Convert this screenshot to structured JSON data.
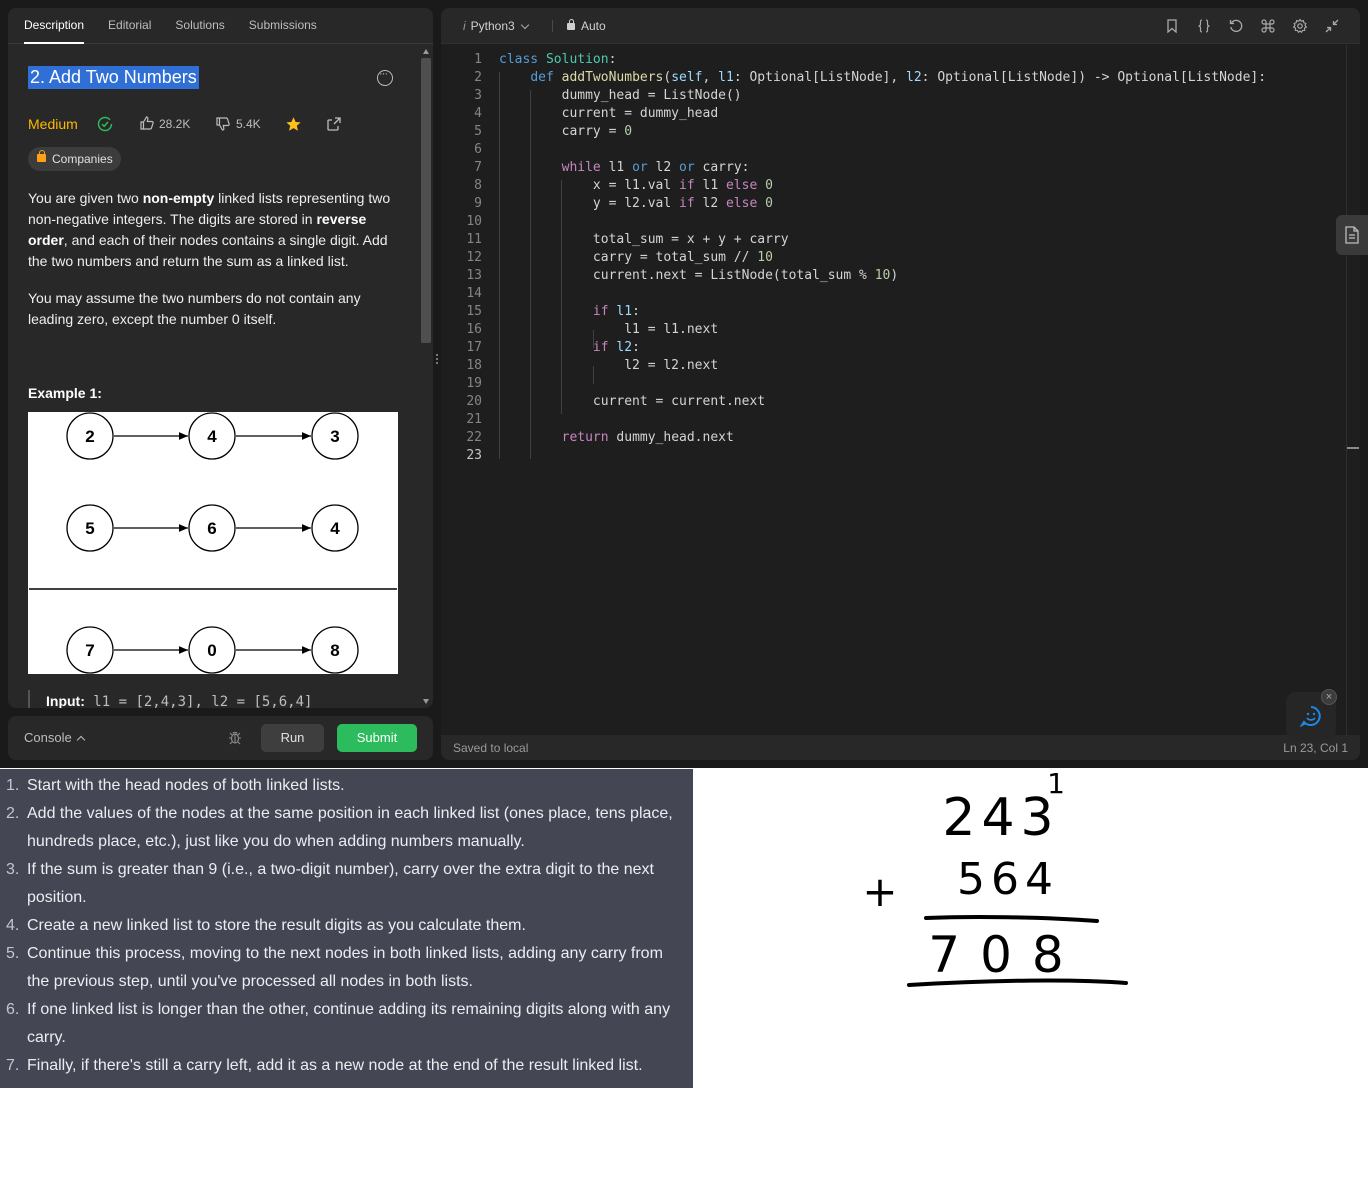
{
  "left_panel": {
    "tabs": [
      "Description",
      "Editorial",
      "Solutions",
      "Submissions"
    ],
    "problem_title": "2. Add Two Numbers",
    "difficulty": "Medium",
    "likes": "28.2K",
    "dislikes": "5.4K",
    "companies_label": "Companies",
    "description_paragraph_1": {
      "t1": "You are given two ",
      "b1": "non-empty",
      "t2": " linked lists representing two non-negative integers. The digits are stored in ",
      "b2": "reverse order",
      "t3": ", and each of their nodes contains a single digit. Add the two numbers and return the sum as a linked list."
    },
    "description_paragraph_2": "You may assume the two numbers do not contain any leading zero, except the number 0 itself.",
    "example_heading": "Example 1:",
    "example_figure": {
      "row1": [
        "2",
        "4",
        "3"
      ],
      "row2": [
        "5",
        "6",
        "4"
      ],
      "row3": [
        "7",
        "0",
        "8"
      ]
    },
    "example_input_label": "Input:",
    "example_input_value": " l1 = [2,4,3], l2 = [5,6,4]"
  },
  "console_bar": {
    "console_label": "Console",
    "run_label": "Run",
    "submit_label": "Submit",
    "submit_color": "#2cbb5d"
  },
  "editor": {
    "language": "Python3",
    "language_icon": "i",
    "mode": "Auto",
    "toolbar_icons": [
      "bookmark-icon",
      "braces-icon",
      "reset-icon",
      "command-icon",
      "settings-icon",
      "collapse-icon"
    ],
    "saved_status": "Saved to local",
    "cursor_position": "Ln 23, Col 1",
    "current_line": "23",
    "code_lines": [
      "class Solution:",
      "    def addTwoNumbers(self, l1: Optional[ListNode], l2: Optional[ListNode]) -> Optional[ListNode]:",
      "        dummy_head = ListNode()",
      "        current = dummy_head",
      "        carry = 0",
      "",
      "        while l1 or l2 or carry:",
      "            x = l1.val if l1 else 0",
      "            y = l2.val if l2 else 0",
      "",
      "            total_sum = x + y + carry",
      "            carry = total_sum // 10",
      "            current.next = ListNode(total_sum % 10)",
      "",
      "            if l1:",
      "                l1 = l1.next",
      "            if l2:",
      "                l2 = l2.next",
      "",
      "            current = current.next",
      "",
      "        return dummy_head.next",
      ""
    ]
  },
  "steps": [
    {
      "n": "1.",
      "text": "Start with the head nodes of both linked lists."
    },
    {
      "n": "2.",
      "text": "Add the values of the nodes at the same position in each linked list (ones place, tens place, hundreds place, etc.), just like you do when adding numbers manually."
    },
    {
      "n": "3.",
      "text": "If the sum is greater than 9 (i.e., a two-digit number), carry over the extra digit to the next position."
    },
    {
      "n": "4.",
      "text": "Create a new linked list to store the result digits as you calculate them."
    },
    {
      "n": "5.",
      "text": "Continue this process, moving to the next nodes in both linked lists, adding any carry from the previous step, until you've processed all nodes in both lists."
    },
    {
      "n": "6.",
      "text": "If one linked list is longer than the other, continue adding its remaining digits along with any carry."
    },
    {
      "n": "7.",
      "text": "Finally, if there's still a carry left, add it as a new node at the end of the result linked list."
    }
  ],
  "handwritten_sum": {
    "carry": "1",
    "top": "243",
    "bottom": "564",
    "operator": "+",
    "result": "708"
  }
}
